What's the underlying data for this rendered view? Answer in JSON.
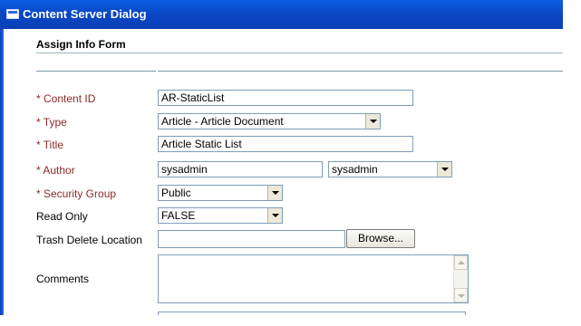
{
  "window": {
    "title": "Content Server Dialog"
  },
  "form": {
    "title": "Assign Info Form"
  },
  "fields": {
    "content_id": {
      "label": "* Content ID",
      "value": "AR-StaticList"
    },
    "type": {
      "label": "* Type",
      "value": "Article - Article Document"
    },
    "title": {
      "label": "* Title",
      "value": "Article Static List"
    },
    "author": {
      "label": "* Author",
      "value": "sysadmin",
      "select_value": "sysadmin"
    },
    "security_group": {
      "label": "* Security Group",
      "value": "Public"
    },
    "read_only": {
      "label": "Read Only",
      "value": "FALSE"
    },
    "trash_delete_location": {
      "label": "Trash Delete Location",
      "value": "",
      "button_label": "Browse..."
    },
    "comments": {
      "label": "Comments",
      "value": ""
    }
  },
  "colors": {
    "titlebar": "#0a47c6",
    "required_label": "#8c2a2a",
    "field_border": "#7f9db9"
  },
  "icons": {
    "window": "window-icon",
    "dropdown": "chevron-down-icon",
    "scroll_up": "arrow-up-icon",
    "scroll_down": "arrow-down-icon"
  }
}
